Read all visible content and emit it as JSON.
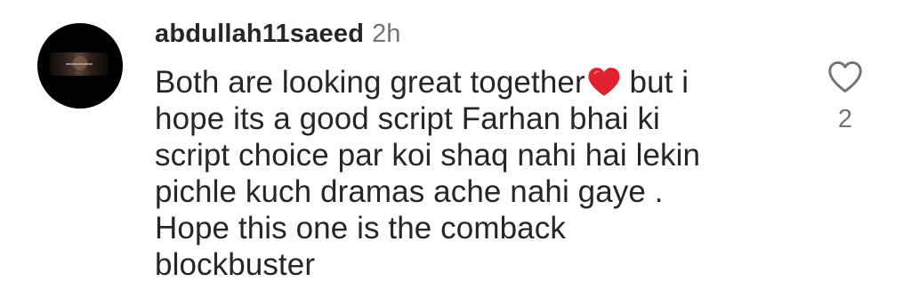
{
  "comment": {
    "username": "abdullah11saeed",
    "timestamp": "2h",
    "text_lines": [
      "Both are looking great together",
      " but i",
      "hope its a good script Farhan bhai ki",
      "script choice par koi shaq nahi hai lekin",
      "pichle kuch dramas ache nahi gaye .",
      "Hope this one is the comback",
      "blockbuster"
    ],
    "emoji": "red-heart-emoji",
    "like_count": "2",
    "like_icon": "heart-outline-icon"
  },
  "colors": {
    "text_primary": "#262626",
    "text_secondary": "#737373",
    "heart_red": "#e0212f",
    "background": "#ffffff"
  }
}
